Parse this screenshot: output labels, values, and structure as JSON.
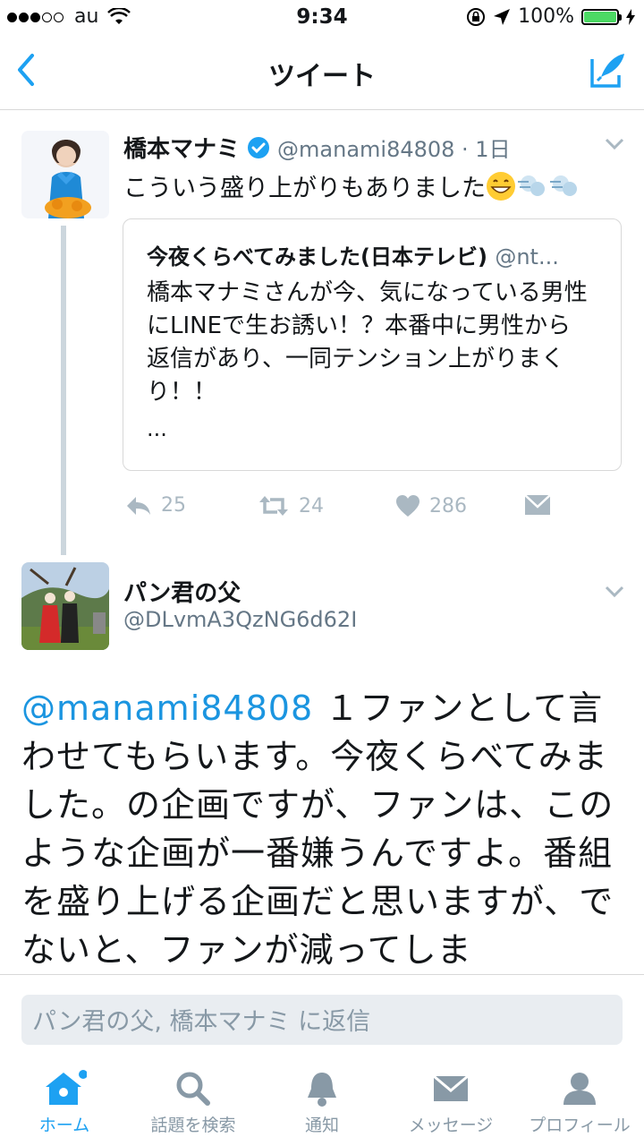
{
  "status_bar": {
    "carrier": "au",
    "time": "9:34",
    "battery": "100%"
  },
  "nav": {
    "title": "ツイート"
  },
  "tweet": {
    "author_name": "橋本マナミ",
    "author_handle": "@manami84808 · 1日",
    "text": "こういう盛り上がりもありました",
    "quote": {
      "name": "今夜くらべてみました(日本テレビ)",
      "handle": "@nt...",
      "text": "橋本マナミさんが今、気になっている男性にLINEで生お誘い！？本番中に男性から返信があり、一同テンション上がりまくり！！",
      "more": "..."
    },
    "stats": {
      "replies": "25",
      "retweets": "24",
      "likes": "286"
    }
  },
  "reply": {
    "author_name": "パン君の父",
    "author_handle": "@DLvmA3QzNG6d62I",
    "mention": "@manami84808",
    "text": " １ファンとして言わせてもらいます。今夜くらべてみました。の企画ですが、ファンは、このような企画が一番嫌うんですよ。番組を盛り上げる企画だと思いますが、でないと、ファンが減ってしま"
  },
  "reply_bar": {
    "placeholder": "パン君の父, 橋本マナミ に返信"
  },
  "tabs": [
    {
      "label": "ホーム",
      "icon": "home-icon",
      "active": true
    },
    {
      "label": "話題を検索",
      "icon": "search-icon"
    },
    {
      "label": "通知",
      "icon": "bell-icon"
    },
    {
      "label": "メッセージ",
      "icon": "envelope-icon"
    },
    {
      "label": "プロフィール",
      "icon": "person-icon"
    }
  ],
  "colors": {
    "accent": "#1da1f2",
    "mention": "#1b95e0",
    "muted": "#8899a6"
  }
}
